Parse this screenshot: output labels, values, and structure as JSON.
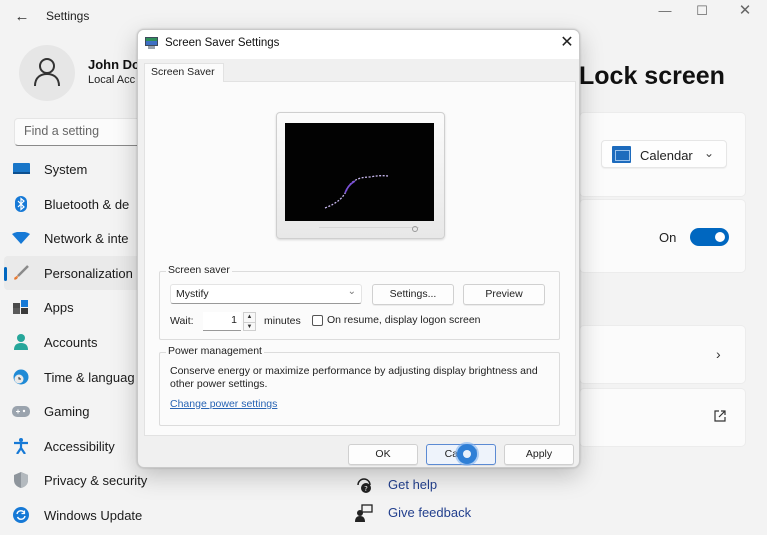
{
  "window": {
    "title": "Settings",
    "controls": {
      "minimize": "—",
      "maximize": "☐",
      "close": "✕"
    }
  },
  "profile": {
    "name": "John Do",
    "account_type": "Local Acc"
  },
  "search": {
    "placeholder": "Find a setting"
  },
  "sidebar": {
    "items": [
      {
        "label": "System",
        "icon": "monitor-icon",
        "active": false
      },
      {
        "label": "Bluetooth & de",
        "icon": "bluetooth-icon",
        "active": false
      },
      {
        "label": "Network & inte",
        "icon": "wifi-icon",
        "active": false
      },
      {
        "label": "Personalization",
        "icon": "brush-icon",
        "active": true
      },
      {
        "label": "Apps",
        "icon": "apps-icon",
        "active": false
      },
      {
        "label": "Accounts",
        "icon": "person-icon",
        "active": false
      },
      {
        "label": "Time & languag",
        "icon": "clock-globe-icon",
        "active": false
      },
      {
        "label": "Gaming",
        "icon": "gamepad-icon",
        "active": false
      },
      {
        "label": "Accessibility",
        "icon": "accessibility-icon",
        "active": false
      },
      {
        "label": "Privacy & security",
        "icon": "shield-icon",
        "active": false
      },
      {
        "label": "Windows Update",
        "icon": "update-icon",
        "active": false
      }
    ]
  },
  "main": {
    "heading": "Lock screen",
    "status_app": {
      "value": "Calendar",
      "icon": "calendar-icon"
    },
    "toggle": {
      "label": "On",
      "state": true
    },
    "help": [
      {
        "label": "Get help",
        "icon": "help-icon"
      },
      {
        "label": "Give feedback",
        "icon": "feedback-icon"
      }
    ]
  },
  "dialog": {
    "title": "Screen Saver Settings",
    "close": "✕",
    "tab": "Screen Saver",
    "screen_saver": {
      "legend": "Screen saver",
      "selected": "Mystify",
      "settings_button": "Settings...",
      "preview_button": "Preview",
      "wait_label": "Wait:",
      "wait_value": "1",
      "minutes_label": "minutes",
      "logon_checkbox_label": "On resume, display logon screen",
      "logon_checked": false
    },
    "power": {
      "legend": "Power management",
      "description": "Conserve energy or maximize performance by adjusting display brightness and other power settings.",
      "link": "Change power settings"
    },
    "buttons": {
      "ok": "OK",
      "cancel": "Cancel",
      "apply": "Apply"
    }
  },
  "colors": {
    "accent": "#0067c0",
    "link": "#2864b4",
    "help_link": "#23408e"
  }
}
